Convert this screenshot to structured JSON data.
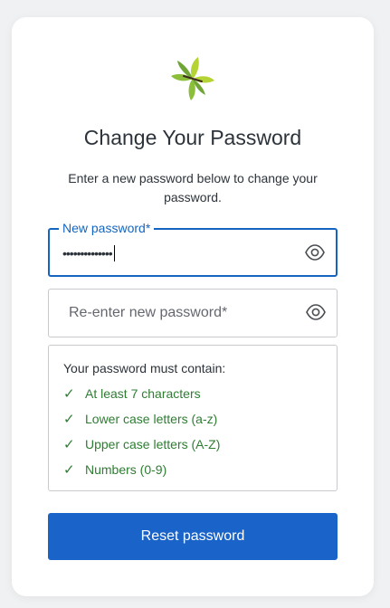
{
  "title": "Change Your Password",
  "subtitle": "Enter a new password below to change your password.",
  "new_password": {
    "label": "New password*",
    "value": "••••••••••••••"
  },
  "reenter_password": {
    "placeholder": "Re-enter new password*"
  },
  "requirements": {
    "title": "Your password must contain:",
    "items": [
      {
        "label": "At least 7 characters",
        "met": true
      },
      {
        "label": "Lower case letters (a-z)",
        "met": true
      },
      {
        "label": "Upper case letters (A-Z)",
        "met": true
      },
      {
        "label": "Numbers (0-9)",
        "met": true
      }
    ],
    "check_glyph": "✓"
  },
  "submit_label": "Reset password",
  "colors": {
    "accent": "#1a63c9",
    "focus_border": "#1565c0",
    "success": "#2e7d32",
    "logo_leaf_light": "#b5d334",
    "logo_leaf_dark": "#6fa535"
  },
  "icons": {
    "logo": "leaf-logo-icon",
    "toggle_visibility": "eye-icon",
    "check": "check-icon"
  }
}
